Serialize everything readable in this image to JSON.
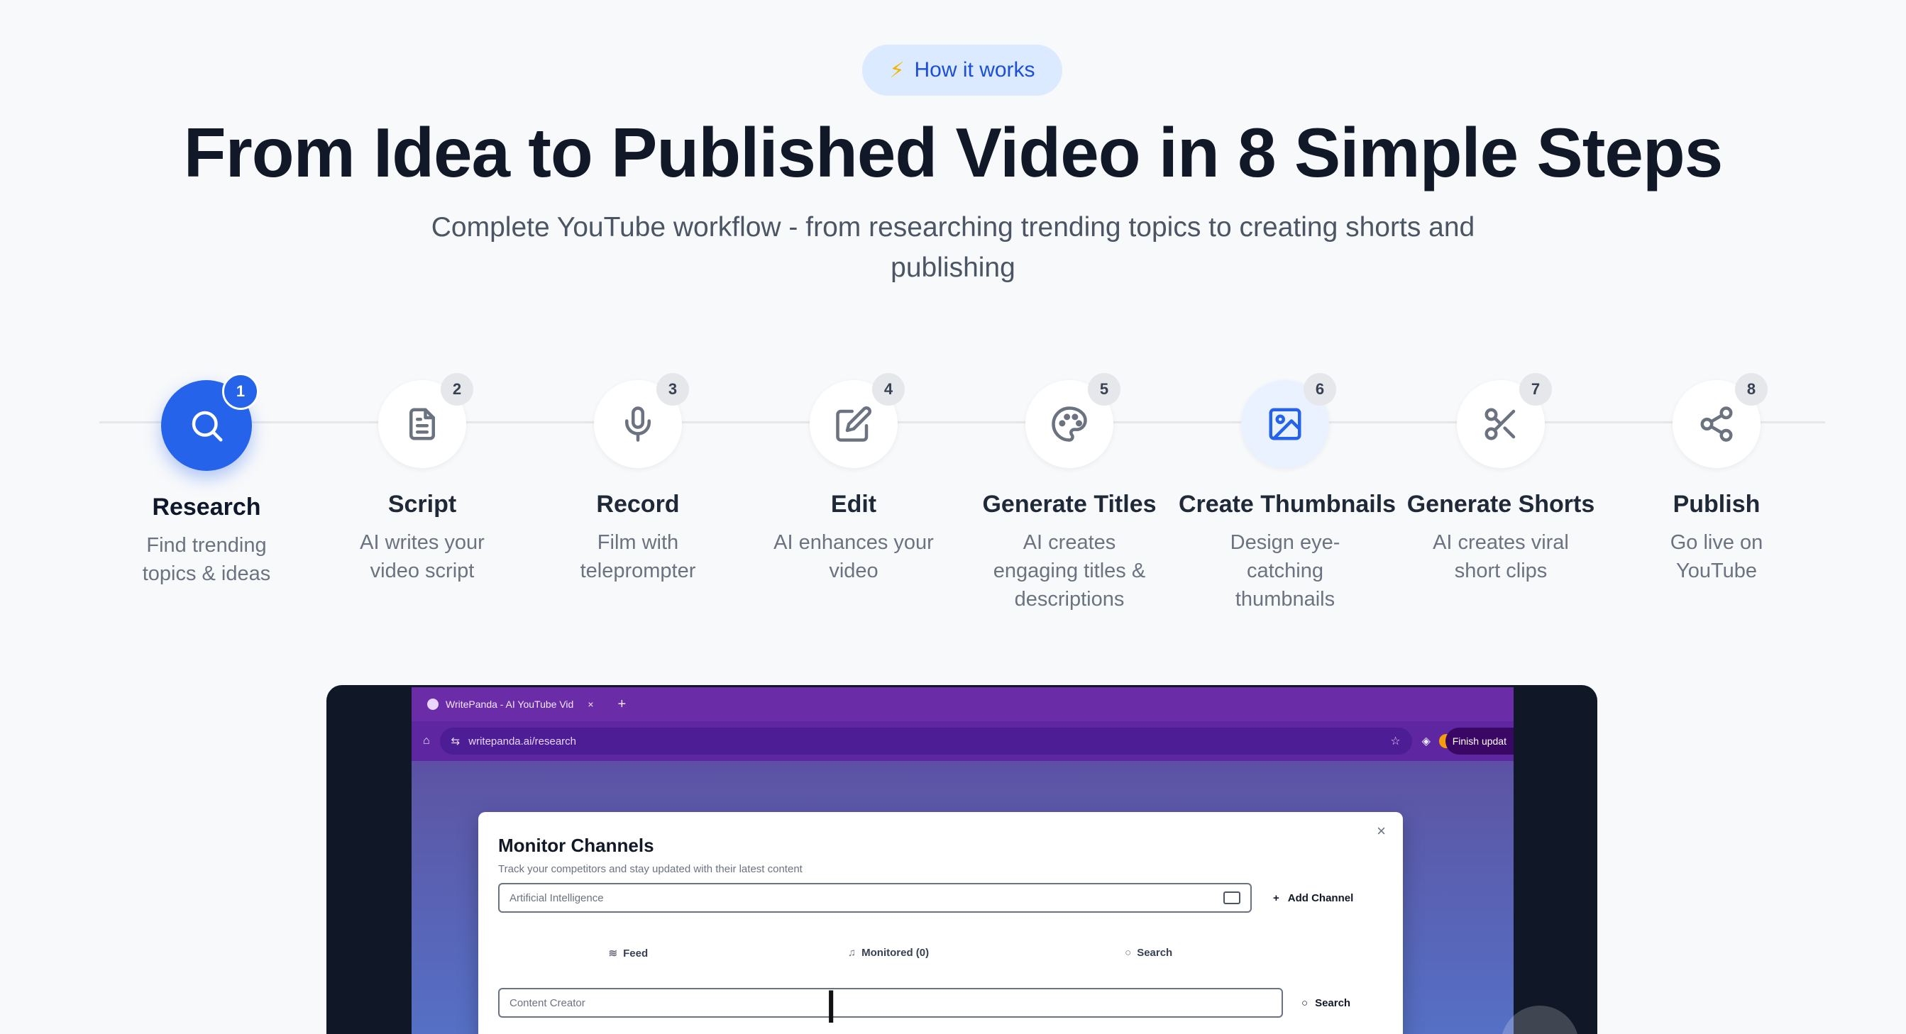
{
  "badge": {
    "icon": "lightning-icon",
    "label": "How it works"
  },
  "headline": "From Idea to Published Video in 8 Simple Steps",
  "subhead": "Complete YouTube workflow - from researching trending topics to creating shorts and publishing",
  "steps": [
    {
      "number": "1",
      "title": "Research",
      "description": "Find trending topics & ideas",
      "icon": "search-icon"
    },
    {
      "number": "2",
      "title": "Script",
      "description": "AI writes your video script",
      "icon": "document-icon"
    },
    {
      "number": "3",
      "title": "Record",
      "description": "Film with teleprompter",
      "icon": "microphone-icon"
    },
    {
      "number": "4",
      "title": "Edit",
      "description": "AI enhances your video",
      "icon": "edit-icon"
    },
    {
      "number": "5",
      "title": "Generate Titles",
      "description": "AI creates engaging titles & descriptions",
      "icon": "palette-icon"
    },
    {
      "number": "6",
      "title": "Create Thumbnails",
      "description": "Design eye-catching thumbnails",
      "icon": "image-icon"
    },
    {
      "number": "7",
      "title": "Generate Shorts",
      "description": "AI creates viral short clips",
      "icon": "scissors-icon"
    },
    {
      "number": "8",
      "title": "Publish",
      "description": "Go live on YouTube",
      "icon": "share-icon"
    }
  ],
  "demo": {
    "browser": {
      "tab_title": "WritePanda - AI YouTube Vid",
      "url": "writepanda.ai/research",
      "finish_button": "Finish updat"
    },
    "modal": {
      "title": "Monitor Channels",
      "subtitle": "Track your competitors and stay updated with their latest content",
      "channel_input_value": "Artificial Intelligence",
      "add_channel_label": "Add Channel",
      "tabs": [
        "Feed",
        "Monitored (0)",
        "Search"
      ],
      "search_input_value": "Content Creator",
      "search_button_label": "Search"
    }
  },
  "colors": {
    "accent": "#2563eb",
    "badge_background": "#dbeafe",
    "page_background": "#f8f9fb",
    "video_frame": "#101827"
  }
}
